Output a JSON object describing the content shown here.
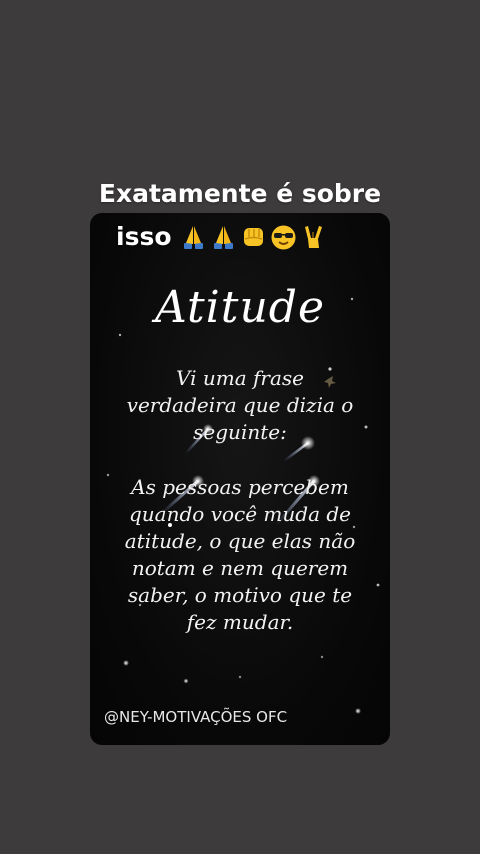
{
  "caption": {
    "line1": "Exatamente é sobre",
    "line2": "isso",
    "emojis": [
      "folded-hands-icon",
      "folded-hands-icon",
      "fist-bump-icon",
      "sunglasses-face-icon",
      "victory-hand-icon"
    ]
  },
  "card": {
    "title": "Atitude",
    "quote_intro": "Vi uma frase verdadeira que dizia o seguinte:",
    "quote_body": "As pessoas percebem quando você muda de atitude, o que elas não notam e nem querem saber, o motivo que te fez mudar.",
    "watermark": "@NEY-MOTIVAÇÕES OFC"
  },
  "colors": {
    "background": "#3d3b3c",
    "card": "#0a0a0a",
    "text": "#ffffff",
    "emoji_yellow": "#f7c325",
    "emoji_blue_sleeve": "#3c79c9"
  }
}
